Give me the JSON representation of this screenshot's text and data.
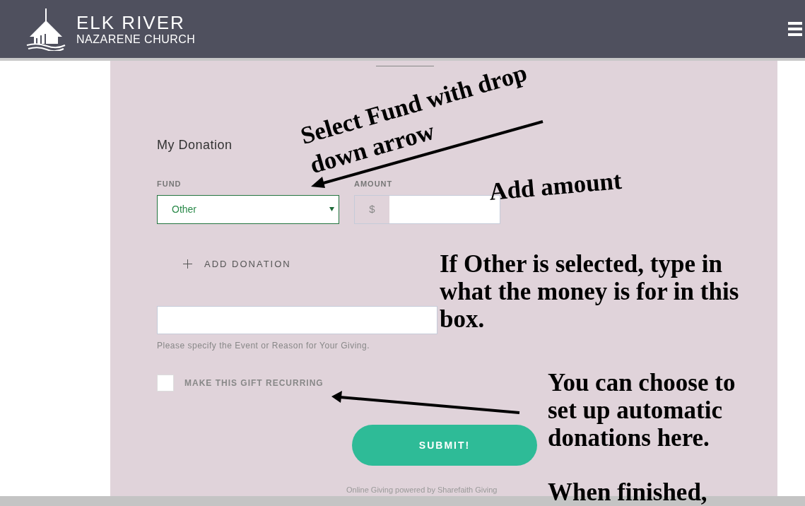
{
  "header": {
    "logo_line1": "ELK RIVER",
    "logo_line2": "NAZARENE CHURCH"
  },
  "form": {
    "title": "My Donation",
    "fund_label": "FUND",
    "fund_value": "Other",
    "amount_label": "AMOUNT",
    "currency": "$",
    "add_donation": "ADD DONATION",
    "reason_hint": "Please specify the Event or Reason for Your Giving.",
    "recurring": {
      "label": "MAKE THIS GIFT RECURRING",
      "checked": false
    },
    "submit": "SUBMIT!",
    "footer": "Online Giving powered by Sharefaith Giving"
  },
  "annotations": [
    {
      "text": "Select Fund with drop",
      "kind": "tilted"
    },
    {
      "text": "down arrow",
      "kind": "tilted"
    },
    {
      "text": "Add amount",
      "kind": "slight"
    },
    {
      "text": "If Other is selected, type in what the money is for in this box.",
      "kind": "plain"
    },
    {
      "text": "You can choose to set up automatic donations here.",
      "kind": "plain"
    },
    {
      "text": "When finished,",
      "kind": "plain"
    }
  ]
}
